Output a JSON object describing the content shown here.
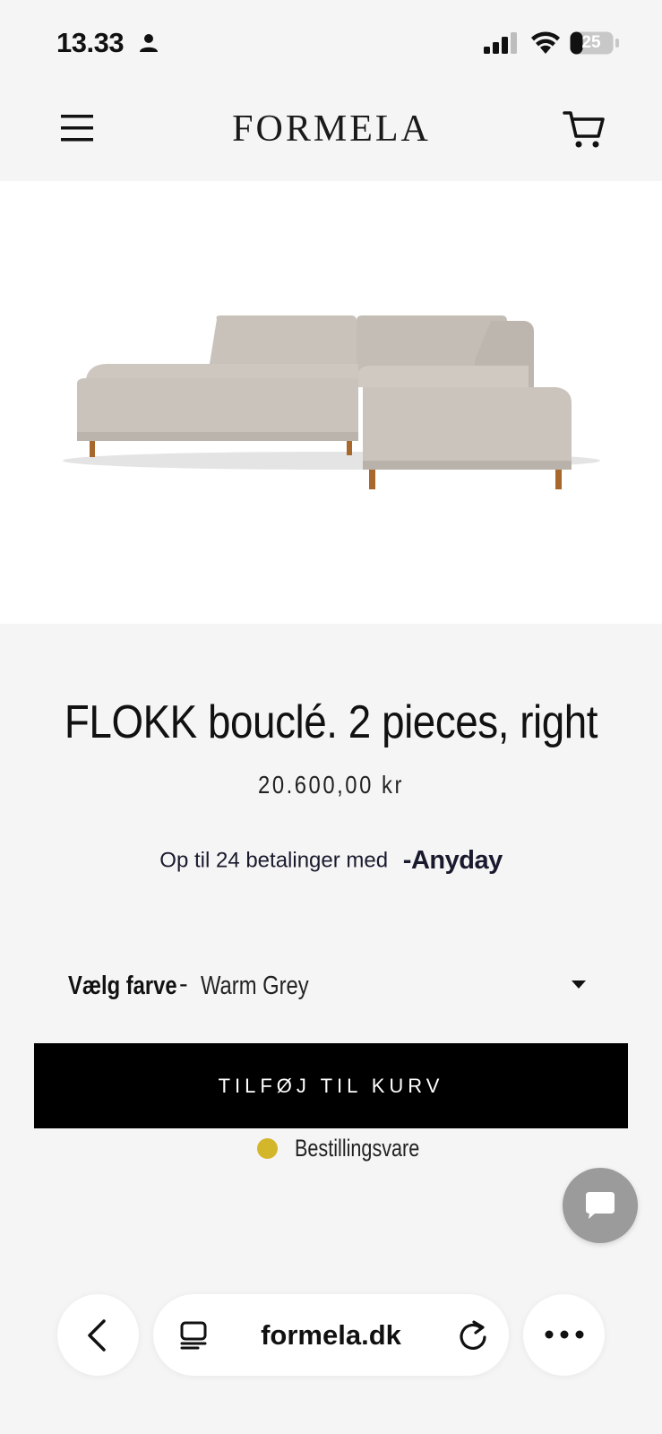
{
  "status_bar": {
    "time": "13.33",
    "battery": "25"
  },
  "header": {
    "logo": "FORMELA",
    "icons": [
      "menu-icon",
      "cart-icon"
    ]
  },
  "product": {
    "title": "FLOKK bouclé. 2 pieces, right",
    "price": "20.600,00 kr",
    "payment_text": "Op til 24 betalinger med",
    "payment_provider": "Anyday",
    "variant_label": "Vælg farve",
    "variant_separator": "-",
    "variant_value": "Warm Grey",
    "add_to_cart": "TILFØJ TIL KURV",
    "stock_status": "Bestillingsvare",
    "stock_color": "#d4b62a"
  },
  "browser": {
    "url": "formela.dk",
    "icons": [
      "back-icon",
      "tabs-icon",
      "reload-icon",
      "more-icon"
    ]
  },
  "colors": {
    "background": "#f5f5f5",
    "button": "#000000",
    "chat": "#9b9b9b"
  }
}
